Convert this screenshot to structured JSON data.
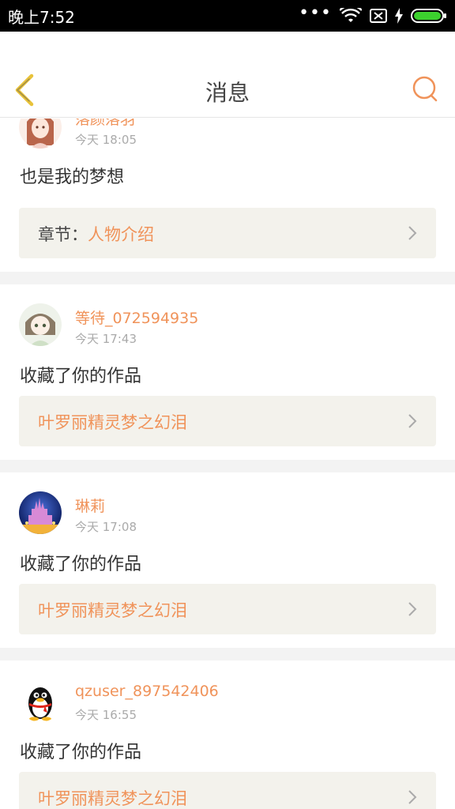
{
  "status_bar": {
    "time": "晚上7:52",
    "icons": [
      "more-dots-icon",
      "wifi-icon",
      "no-sim-icon",
      "charging-icon",
      "battery-icon"
    ]
  },
  "nav": {
    "title": "消息",
    "back_icon": "chevron-left-icon",
    "search_icon": "search-icon"
  },
  "colors": {
    "accent": "#f0935a",
    "back_arrow": "#e8c23a",
    "ref_background": "#f3f2ec",
    "divider": "#f3f3f3"
  },
  "messages": [
    {
      "username": "落颜落羽",
      "time": "今天 18:05",
      "text": "也是我的梦想",
      "ref_prefix": "章节：",
      "ref_title": "人物介绍"
    },
    {
      "username": "等待_072594935",
      "time": "今天 17:43",
      "text": "收藏了你的作品",
      "ref_prefix": "",
      "ref_title": "叶罗丽精灵梦之幻泪"
    },
    {
      "username": "琳莉",
      "time": "今天 17:08",
      "text": "收藏了你的作品",
      "ref_prefix": "",
      "ref_title": "叶罗丽精灵梦之幻泪"
    },
    {
      "username": "qzuser_897542406",
      "time": "今天 16:55",
      "text": "收藏了你的作品",
      "ref_prefix": "",
      "ref_title": "叶罗丽精灵梦之幻泪"
    }
  ]
}
